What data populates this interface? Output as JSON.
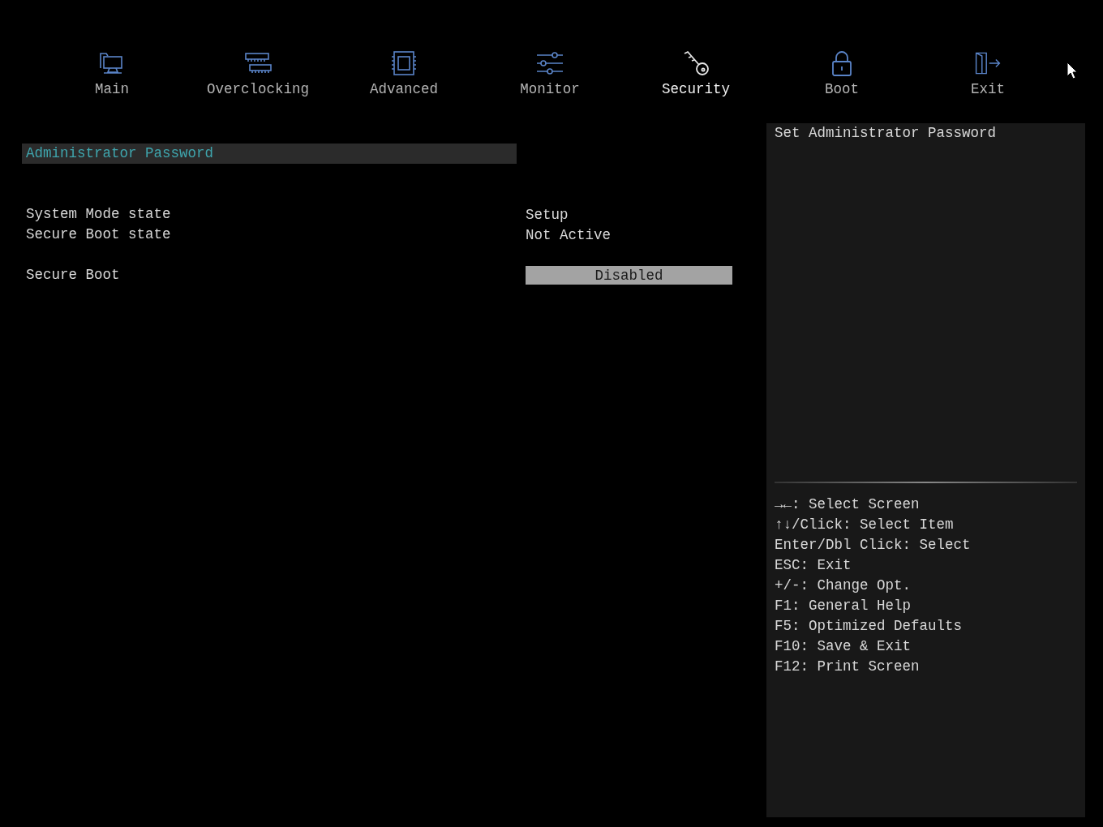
{
  "tabs": [
    {
      "label": "Main",
      "kind": "monitor",
      "selected": false
    },
    {
      "label": "Overclocking",
      "kind": "memory",
      "selected": false
    },
    {
      "label": "Advanced",
      "kind": "chip",
      "selected": false
    },
    {
      "label": "Monitor",
      "kind": "sliders",
      "selected": false
    },
    {
      "label": "Security",
      "kind": "key",
      "selected": true
    },
    {
      "label": "Boot",
      "kind": "lock",
      "selected": false
    },
    {
      "label": "Exit",
      "kind": "exit",
      "selected": false
    }
  ],
  "items": [
    {
      "kind": "submenu",
      "label": "Administrator Password",
      "selected": true
    },
    {
      "kind": "blank"
    },
    {
      "kind": "blank"
    },
    {
      "kind": "info",
      "label": "System Mode state",
      "value": "Setup",
      "selected": false
    },
    {
      "kind": "info",
      "label": "Secure Boot state",
      "value": "Not Active",
      "selected": false
    },
    {
      "kind": "blank"
    },
    {
      "kind": "option",
      "label": "Secure Boot",
      "value": "Disabled",
      "selected": false
    }
  ],
  "help": {
    "text": "Set Administrator Password",
    "keys": [
      "→←: Select Screen",
      "↑↓/Click: Select Item",
      "Enter/Dbl Click: Select",
      "ESC: Exit",
      "+/-: Change Opt.",
      "F1: General Help",
      "F5: Optimized Defaults",
      "F10: Save & Exit",
      "F12: Print Screen"
    ]
  }
}
